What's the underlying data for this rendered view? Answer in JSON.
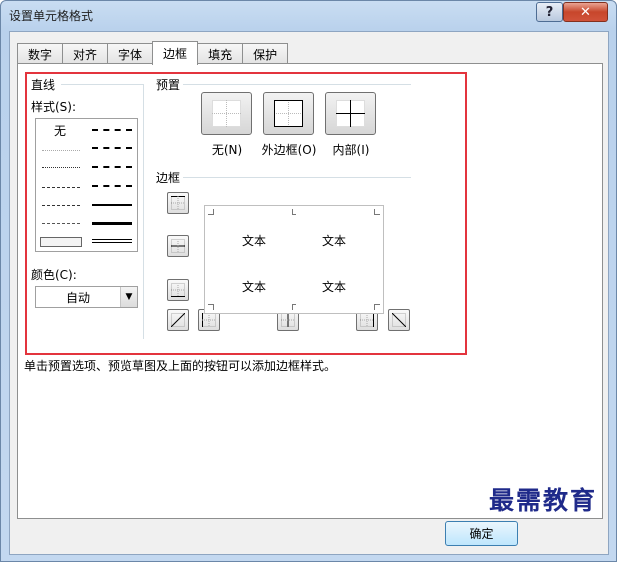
{
  "window": {
    "title": "设置单元格格式",
    "help_label": "?",
    "close_label": "✕"
  },
  "tabs": [
    {
      "label": "数字"
    },
    {
      "label": "对齐"
    },
    {
      "label": "字体"
    },
    {
      "label": "边框",
      "active": true
    },
    {
      "label": "填充"
    },
    {
      "label": "保护"
    }
  ],
  "line": {
    "group_label": "直线",
    "style_label": "样式(S):",
    "none_label": "无",
    "color_label": "颜色(C):",
    "color_value": "自动"
  },
  "presets": {
    "group_label": "预置",
    "items": [
      {
        "label": "无(N)"
      },
      {
        "label": "外边框(O)"
      },
      {
        "label": "内部(I)"
      }
    ]
  },
  "border": {
    "group_label": "边框",
    "preview_texts": [
      "文本",
      "文本",
      "文本",
      "文本"
    ]
  },
  "hint": "单击预置选项、预览草图及上面的按钮可以添加边框样式。",
  "footer": {
    "ok_label": "确定",
    "watermark": "最需教育"
  },
  "colors": {
    "highlight_box": "#e3343d",
    "title_gradient": "#c3d8f0",
    "close_button": "#c7462b"
  }
}
